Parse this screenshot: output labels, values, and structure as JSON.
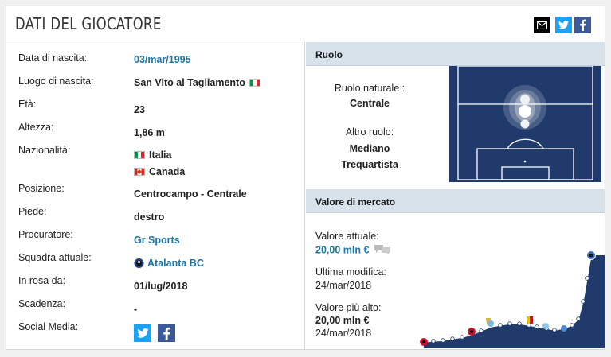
{
  "header": {
    "title": "DATI DEL GIOCATORE",
    "share_icons": [
      "mail-icon",
      "twitter-icon",
      "facebook-icon"
    ]
  },
  "player": {
    "rows": [
      {
        "label": "Data di nascita:",
        "value": "03/mar/1995"
      },
      {
        "label": "Luogo di nascita:",
        "value": "San Vito al Tagliamento"
      },
      {
        "label": "Età:",
        "value": "23"
      },
      {
        "label": "Altezza:",
        "value": "1,86 m"
      },
      {
        "label": "Nazionalità:",
        "value": "Italia",
        "value2": "Canada"
      },
      {
        "label": "Posizione:",
        "value": "Centrocampo - Centrale"
      },
      {
        "label": "Piede:",
        "value": "destro"
      },
      {
        "label": "Procuratore:",
        "value": "Gr Sports"
      },
      {
        "label": "Squadra attuale:",
        "value": "Atalanta BC"
      },
      {
        "label": "In rosa da:",
        "value": "01/lug/2018"
      },
      {
        "label": "Scadenza:",
        "value": "-"
      },
      {
        "label": "Social Media:",
        "value": ""
      }
    ]
  },
  "ruolo": {
    "heading": "Ruolo",
    "natural_label": "Ruolo naturale :",
    "natural_value": "Centrale",
    "other_label": "Altro ruolo:",
    "other_values": [
      "Mediano",
      "Trequartista"
    ]
  },
  "market": {
    "heading": "Valore di mercato",
    "current_label": "Valore attuale:",
    "current_value": "20,00 mln €",
    "last_change_label": "Ultima modifica:",
    "last_change_date": "24/mar/2018",
    "highest_label": "Valore più alto:",
    "highest_value": "20,00 mln €",
    "highest_date": "24/mar/2018"
  },
  "colors": {
    "link": "#1d75a3",
    "section_header": "#d7e2eb",
    "pitch": "#1f3a6b"
  }
}
